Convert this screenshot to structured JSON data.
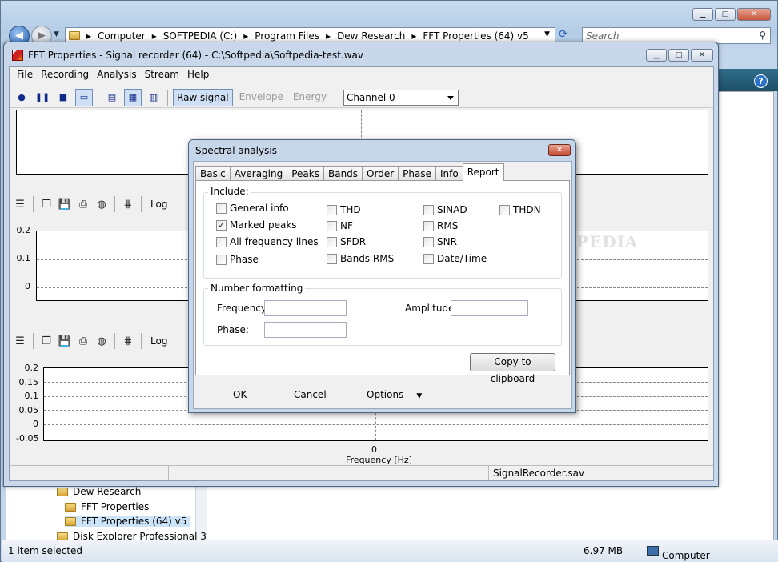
{
  "explorer": {
    "breadcrumb": [
      "Computer",
      "SOFTPEDIA (C:)",
      "Program Files",
      "Dew Research",
      "FFT Properties (64) v5"
    ],
    "search_placeholder": "Search",
    "tree": [
      "Dew Research",
      "FFT Properties",
      "FFT Properties (64) v5",
      "Disk Explorer Professional 3"
    ],
    "status": {
      "selection": "1 item selected",
      "size": "6.97 MB",
      "location": "Computer"
    }
  },
  "app": {
    "title": "FFT Properties - Signal recorder (64) - C:\\Softpedia\\Softpedia-test.wav",
    "menu": [
      "File",
      "Recording",
      "Analysis",
      "Stream",
      "Help"
    ],
    "toolbar": {
      "modes": [
        "Raw signal",
        "Envelope",
        "Energy"
      ],
      "channel": "Channel 0"
    },
    "subtoolbar": {
      "log_label": "Log"
    },
    "plot1": {
      "yticks": [
        "0.2",
        "0.1",
        "0"
      ]
    },
    "plot2": {
      "yticks": [
        "0.2",
        "0.15",
        "0.1",
        "0.05",
        "0",
        "-0.05"
      ],
      "xtick": "0",
      "xlabel": "Frequency [Hz]"
    },
    "statusbar": {
      "file": "SignalRecorder.sav"
    }
  },
  "dialog": {
    "title": "Spectral analysis",
    "tabs": [
      "Basic",
      "Averaging",
      "Peaks",
      "Bands",
      "Order",
      "Phase",
      "Info",
      "Report"
    ],
    "active_tab": "Report",
    "include_label": "Include:",
    "checkboxes": [
      {
        "label": "General info",
        "checked": false
      },
      {
        "label": "Marked peaks",
        "checked": true
      },
      {
        "label": "All frequency lines",
        "checked": false
      },
      {
        "label": "Phase",
        "checked": false
      },
      {
        "label": "THD",
        "checked": false
      },
      {
        "label": "NF",
        "checked": false
      },
      {
        "label": "SFDR",
        "checked": false
      },
      {
        "label": "Bands RMS",
        "checked": false
      },
      {
        "label": "SINAD",
        "checked": false
      },
      {
        "label": "RMS",
        "checked": false
      },
      {
        "label": "SNR",
        "checked": false
      },
      {
        "label": "Date/Time",
        "checked": false
      },
      {
        "label": "THDN",
        "checked": false
      }
    ],
    "number_formatting_label": "Number formatting",
    "frequency_label": "Frequency:",
    "amplitude_label": "Amplitude:",
    "phase_label": "Phase:",
    "frequency_value": "",
    "amplitude_value": "",
    "phase_value": "",
    "copy_button": "Copy to clipboard",
    "ok": "OK",
    "cancel": "Cancel",
    "options": "Options"
  },
  "watermark": "SOFTPEDIA"
}
